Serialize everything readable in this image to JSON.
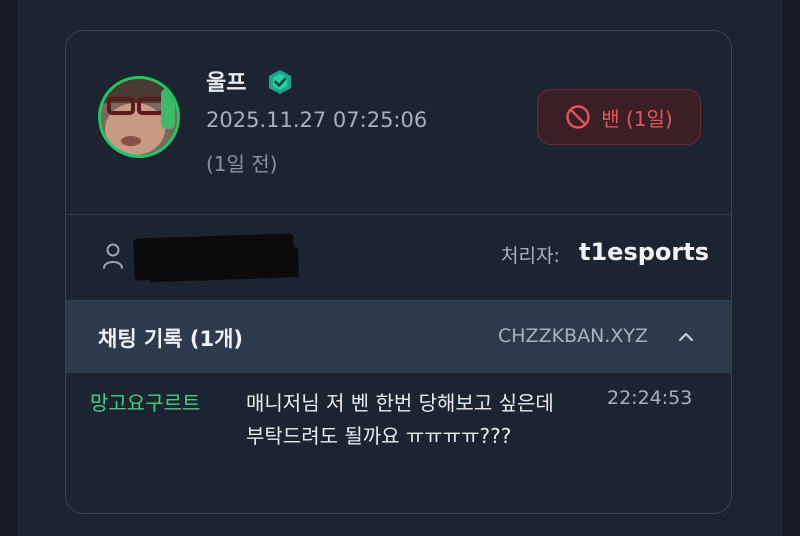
{
  "user": {
    "name": "울프",
    "datetime": "2025.11.27 07:25:06",
    "relative_time": "(1일 전)",
    "verified": true,
    "accent_color": "#1ec95f"
  },
  "ban_badge": {
    "icon": "ban-icon",
    "label": "밴 (1일)",
    "color": "#e5555e"
  },
  "info": {
    "person_icon": "person-icon",
    "processor_label": "처리자:",
    "processor_value": "t1esports"
  },
  "chat_log": {
    "title": "채팅 기록 (1개)",
    "source": "CHZZKBAN.XYZ",
    "toggle_icon": "chevron-up-icon",
    "messages": [
      {
        "user": "망고요구르트",
        "text": "매니저님 저 벤 한번 당해보고 싶은데 부탁드려도 될까요 ㅠㅠㅠㅠ???",
        "time": "22:24:53",
        "user_color": "#3fcf85"
      }
    ]
  }
}
